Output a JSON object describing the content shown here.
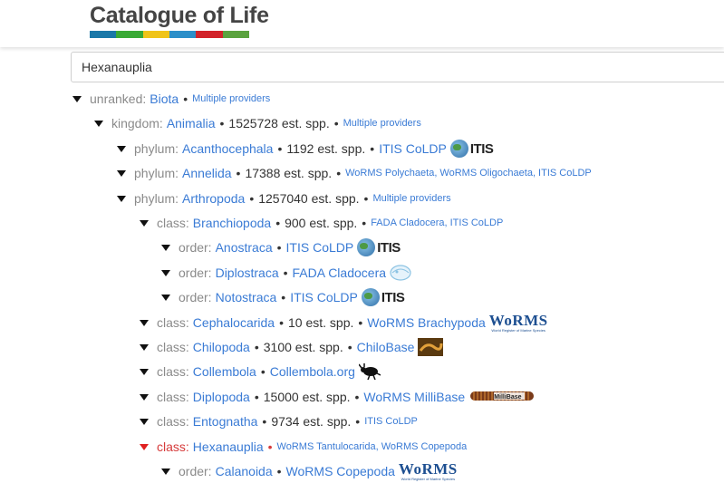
{
  "app": {
    "title": "Catalogue of Life",
    "brand_colors": [
      "#1a78a8",
      "#3aaa35",
      "#f0c419",
      "#2c8fc9",
      "#d2232a",
      "#5ba33f"
    ]
  },
  "search": {
    "value": "Hexanauplia"
  },
  "tree": [
    {
      "rank": "unranked:",
      "name": "Biota",
      "est": "",
      "providers": "Multiple providers"
    },
    {
      "rank": "kingdom:",
      "name": "Animalia",
      "est": "1525728 est. spp.",
      "providers": "Multiple providers"
    },
    {
      "rank": "phylum:",
      "name": "Acanthocephala",
      "est": "1192 est. spp.",
      "providers": "ITIS CoLDP",
      "badge": "itis-logo"
    },
    {
      "rank": "phylum:",
      "name": "Annelida",
      "est": "17388 est. spp.",
      "providers": "WoRMS Polychaeta, WoRMS Oligochaeta, ITIS CoLDP"
    },
    {
      "rank": "phylum:",
      "name": "Arthropoda",
      "est": "1257040 est. spp.",
      "providers": "Multiple providers"
    },
    {
      "rank": "class:",
      "name": "Branchiopoda",
      "est": "900 est. spp.",
      "providers": "FADA Cladocera, ITIS CoLDP"
    },
    {
      "rank": "order:",
      "name": "Anostraca",
      "est": "",
      "providers": "ITIS CoLDP",
      "badge": "itis-logo"
    },
    {
      "rank": "order:",
      "name": "Diplostraca",
      "est": "",
      "providers": "FADA Cladocera",
      "badge": "fada-logo"
    },
    {
      "rank": "order:",
      "name": "Notostraca",
      "est": "",
      "providers": "ITIS CoLDP",
      "badge": "itis-logo"
    },
    {
      "rank": "class:",
      "name": "Cephalocarida",
      "est": "10 est. spp.",
      "providers": "WoRMS Brachypoda",
      "badge": "worms-logo"
    },
    {
      "rank": "class:",
      "name": "Chilopoda",
      "est": "3100 est. spp.",
      "providers": "ChiloBase",
      "badge": "chilobase-logo"
    },
    {
      "rank": "class:",
      "name": "Collembola",
      "est": "",
      "providers": "Collembola.org",
      "badge": "collembola-logo"
    },
    {
      "rank": "class:",
      "name": "Diplopoda",
      "est": "15000 est. spp.",
      "providers": "WoRMS MilliBase",
      "badge": "millibase-logo"
    },
    {
      "rank": "class:",
      "name": "Entognatha",
      "est": "9734 est. spp.",
      "providers": "ITIS CoLDP"
    },
    {
      "rank": "class:",
      "name": "Hexanauplia",
      "est": "",
      "providers": "WoRMS Tantulocarida, WoRMS Copepoda",
      "active": true
    },
    {
      "rank": "order:",
      "name": "Calanoida",
      "est": "",
      "providers": "WoRMS Copepoda",
      "badge": "worms-logo"
    }
  ],
  "badges": {
    "itis_text": "ITIS",
    "worms_text": "WoRMS",
    "worms_sub": "World Register of Marine Species",
    "millibase_text": "MilliBase",
    "chilobase_text": "Chilo Base"
  }
}
